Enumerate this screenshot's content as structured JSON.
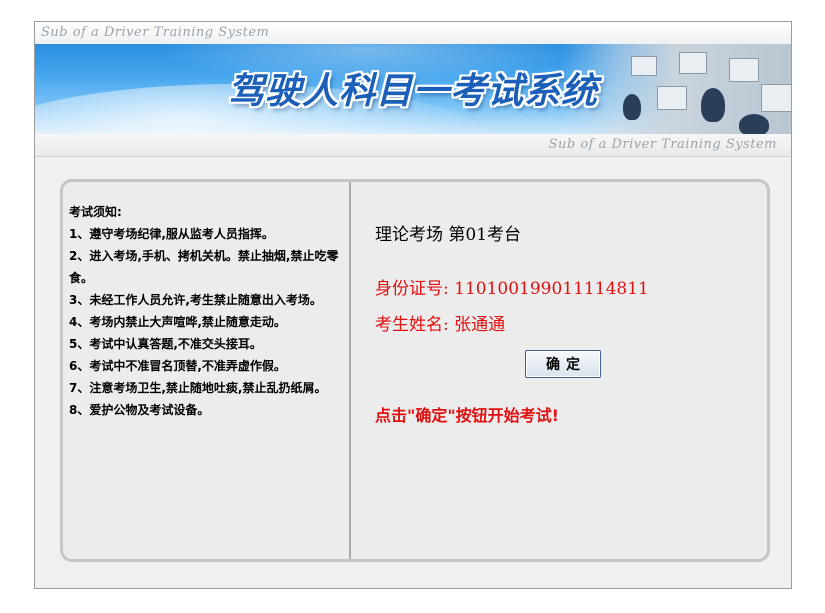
{
  "header": {
    "subtitle_top": "Sub of a Driver Training System",
    "banner_title": "驾驶人科目一考试系统",
    "subtitle_right": "Sub of a Driver Training System"
  },
  "notice": {
    "title": "考试须知:",
    "items": [
      "1、遵守考场纪律,服从监考人员指挥。",
      "2、进入考场,手机、拷机关机。禁止抽烟,禁止吃零食。",
      "3、未经工作人员允许,考生禁止随意出入考场。",
      "4、考场内禁止大声喧哗,禁止随意走动。",
      "5、考试中认真答题,不准交头接耳。",
      "6、考试中不准冒名顶替,不准弄虚作假。",
      "7、注意考场卫生,禁止随地吐痰,禁止乱扔纸屑。",
      "8、爱护公物及考试设备。"
    ]
  },
  "info": {
    "room": "理论考场",
    "seat": "第01考台",
    "id_label": "身份证号:",
    "id_value": "110100199011114811",
    "name_label": "考生姓名:",
    "name_value": "张通通",
    "confirm_label": "确定",
    "hint": "点击\"确定\"按钮开始考试!"
  },
  "colors": {
    "banner_blue": "#2a8fe0",
    "title_blue": "#1b5fb8",
    "alert_red": "#e01010"
  }
}
